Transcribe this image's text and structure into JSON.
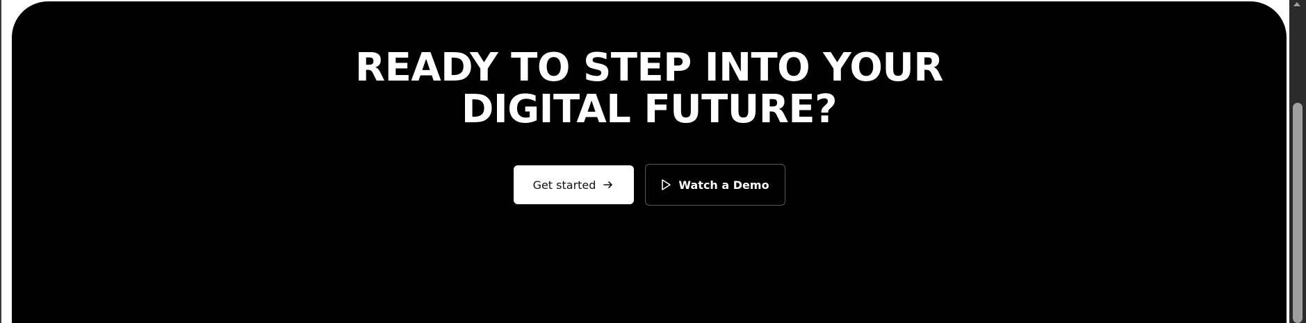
{
  "cta": {
    "headline_line1": "READY TO STEP INTO YOUR",
    "headline_line2": "DIGITAL FUTURE?",
    "primary_button_label": "Get started",
    "secondary_button_label": "Watch a Demo"
  },
  "icons": {
    "primary_button_icon": "arrow-right-icon",
    "secondary_button_icon": "play-icon"
  },
  "colors": {
    "page_background": "#ffffff",
    "section_background": "#000000",
    "headline_text": "#ffffff",
    "primary_button_bg": "#ffffff",
    "primary_button_text": "#111111",
    "secondary_button_border": "#5a5a5a",
    "scrollbar_track": "#2b2b2b",
    "scrollbar_thumb": "#a0a0a0"
  }
}
